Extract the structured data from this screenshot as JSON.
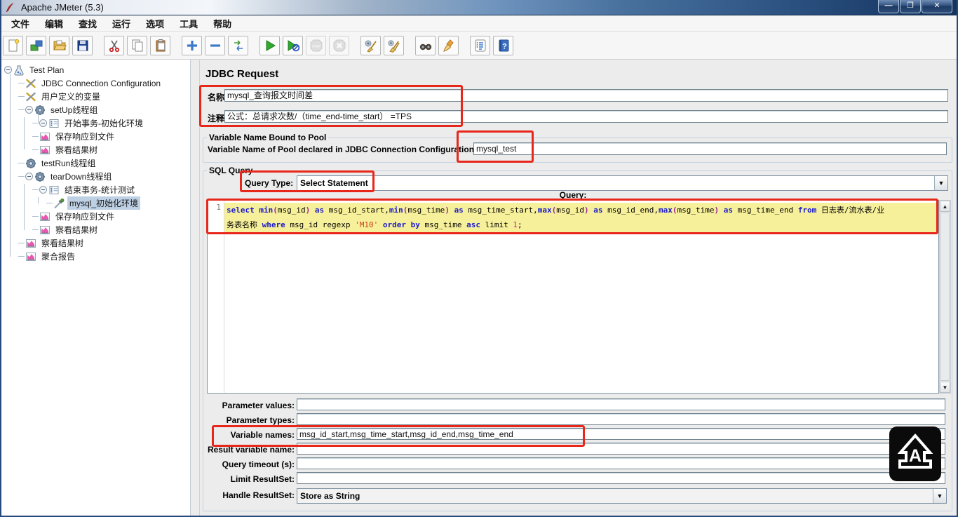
{
  "window": {
    "title": "Apache JMeter (5.3)",
    "minimize": "—",
    "maximize": "❐",
    "close": "✕"
  },
  "menu": {
    "items": [
      "文件",
      "编辑",
      "查找",
      "运行",
      "选项",
      "工具",
      "帮助"
    ]
  },
  "toolbar": {
    "buttons": [
      {
        "name": "new-file",
        "enabled": true
      },
      {
        "name": "templates",
        "enabled": true
      },
      {
        "name": "open-file",
        "enabled": true
      },
      {
        "name": "save-file",
        "enabled": true
      },
      {
        "name": "gap"
      },
      {
        "name": "cut",
        "enabled": true
      },
      {
        "name": "copy",
        "enabled": true
      },
      {
        "name": "paste",
        "enabled": true
      },
      {
        "name": "gap"
      },
      {
        "name": "add",
        "enabled": true
      },
      {
        "name": "remove",
        "enabled": true
      },
      {
        "name": "toggle",
        "enabled": true
      },
      {
        "name": "gap"
      },
      {
        "name": "start",
        "enabled": true
      },
      {
        "name": "start-no-pauses",
        "enabled": true
      },
      {
        "name": "stop",
        "enabled": false
      },
      {
        "name": "shutdown",
        "enabled": false
      },
      {
        "name": "gap"
      },
      {
        "name": "clear",
        "enabled": true
      },
      {
        "name": "clear-all",
        "enabled": true
      },
      {
        "name": "gap"
      },
      {
        "name": "search",
        "enabled": true
      },
      {
        "name": "search-reset",
        "enabled": true
      },
      {
        "name": "gap"
      },
      {
        "name": "function-helper",
        "enabled": true
      },
      {
        "name": "help",
        "enabled": true
      }
    ]
  },
  "tree": {
    "items": [
      {
        "label": "Test Plan",
        "icon": "testplan",
        "level": 0,
        "expanded": true,
        "selected": false
      },
      {
        "label": "JDBC Connection Configuration",
        "icon": "config",
        "level": 1,
        "expanded": false,
        "selected": false
      },
      {
        "label": "用户定义的变量",
        "icon": "config",
        "level": 1,
        "expanded": false,
        "selected": false
      },
      {
        "label": "setUp线程组",
        "icon": "threadgroup",
        "level": 1,
        "expanded": true,
        "selected": false
      },
      {
        "label": "开始事务-初始化环境",
        "icon": "controller",
        "level": 2,
        "expanded": true,
        "selected": false
      },
      {
        "label": "保存响应到文件",
        "icon": "listener",
        "level": 2,
        "expanded": false,
        "selected": false
      },
      {
        "label": "察看结果树",
        "icon": "listener",
        "level": 2,
        "expanded": false,
        "selected": false
      },
      {
        "label": "testRun线程组",
        "icon": "threadgroup",
        "level": 1,
        "expanded": false,
        "selected": false
      },
      {
        "label": "tearDown线程组",
        "icon": "threadgroup",
        "level": 1,
        "expanded": true,
        "selected": false
      },
      {
        "label": "结束事务-统计测试",
        "icon": "controller",
        "level": 2,
        "expanded": true,
        "selected": false
      },
      {
        "label": "mysql_初始化环境",
        "icon": "sampler",
        "level": 3,
        "expanded": false,
        "selected": true
      },
      {
        "label": "保存响应到文件",
        "icon": "listener",
        "level": 2,
        "expanded": false,
        "selected": false
      },
      {
        "label": "察看结果树",
        "icon": "listener",
        "level": 2,
        "expanded": false,
        "selected": false
      },
      {
        "label": "察看结果树",
        "icon": "listener",
        "level": 1,
        "expanded": false,
        "selected": false
      },
      {
        "label": "聚合报告",
        "icon": "listener",
        "level": 1,
        "expanded": false,
        "selected": false
      }
    ]
  },
  "form": {
    "title": "JDBC Request",
    "name_label": "名称:",
    "name_value": "mysql_查询报文时间差",
    "comment_label": "注释:",
    "comment_value": "公式：总请求次数/（time_end-time_start） =TPS",
    "pool_group_title": "Variable Name Bound to Pool",
    "pool_label": "Variable Name of Pool declared in JDBC Connection Configuration:",
    "pool_value": "mysql_test",
    "sql_group_title": "SQL Query",
    "query_type_label": "Query Type:",
    "query_type_value": "Select Statement",
    "query_label": "Query:",
    "sql_line_number": "1",
    "sql_lines": [
      [
        {
          "t": "select ",
          "c": "kw"
        },
        {
          "t": "min",
          "c": "kw"
        },
        {
          "t": "(",
          "c": "sep"
        },
        {
          "t": "msg_id",
          "c": "p"
        },
        {
          "t": ")",
          "c": "sep"
        },
        {
          "t": " ",
          "c": "p"
        },
        {
          "t": "as",
          "c": "kw"
        },
        {
          "t": " msg_id_start,",
          "c": "p"
        },
        {
          "t": "min",
          "c": "kw"
        },
        {
          "t": "(",
          "c": "sep"
        },
        {
          "t": "msg_time",
          "c": "p"
        },
        {
          "t": ")",
          "c": "sep"
        },
        {
          "t": " ",
          "c": "p"
        },
        {
          "t": "as",
          "c": "kw"
        },
        {
          "t": " msg_time_start,",
          "c": "p"
        },
        {
          "t": "max",
          "c": "kw"
        },
        {
          "t": "(",
          "c": "sep"
        },
        {
          "t": "msg_id",
          "c": "p"
        },
        {
          "t": ")",
          "c": "sep"
        },
        {
          "t": " ",
          "c": "p"
        },
        {
          "t": "as",
          "c": "kw"
        },
        {
          "t": " msg_id_end,",
          "c": "p"
        },
        {
          "t": "max",
          "c": "kw"
        },
        {
          "t": "(",
          "c": "sep"
        },
        {
          "t": "msg_time",
          "c": "p"
        },
        {
          "t": ")",
          "c": "sep"
        },
        {
          "t": " ",
          "c": "p"
        },
        {
          "t": "as",
          "c": "kw"
        },
        {
          "t": " msg_time_end ",
          "c": "p"
        },
        {
          "t": "from",
          "c": "kw"
        },
        {
          "t": " 日志表/流水表/业",
          "c": "p"
        }
      ],
      [
        {
          "t": "务表名称 ",
          "c": "p"
        },
        {
          "t": "where",
          "c": "kw"
        },
        {
          "t": " msg_id regexp ",
          "c": "p"
        },
        {
          "t": "'M10'",
          "c": "str"
        },
        {
          "t": " ",
          "c": "p"
        },
        {
          "t": "order",
          "c": "kw"
        },
        {
          "t": " ",
          "c": "p"
        },
        {
          "t": "by",
          "c": "kw"
        },
        {
          "t": " msg_time ",
          "c": "p"
        },
        {
          "t": "asc",
          "c": "kw"
        },
        {
          "t": " limit ",
          "c": "p"
        },
        {
          "t": "1",
          "c": "num"
        },
        {
          "t": ";",
          "c": "p"
        }
      ]
    ],
    "param_rows": [
      {
        "label": "Parameter values:",
        "value": ""
      },
      {
        "label": "Parameter types:",
        "value": ""
      },
      {
        "label": "Variable names:",
        "value": "msg_id_start,msg_time_start,msg_id_end,msg_time_end"
      },
      {
        "label": "Result variable name:",
        "value": ""
      },
      {
        "label": "Query timeout (s):",
        "value": ""
      },
      {
        "label": "Limit ResultSet:",
        "value": ""
      }
    ],
    "handle_resultset_label": "Handle ResultSet:",
    "handle_resultset_value": "Store as String"
  },
  "colors": {
    "annotation_red": "#e8271b",
    "tree_selection": "#bed0e4",
    "sql_line_highlight": "#f7f09b",
    "sql_keyword": "#1a1acd",
    "sql_string": "#cf3a1c"
  }
}
